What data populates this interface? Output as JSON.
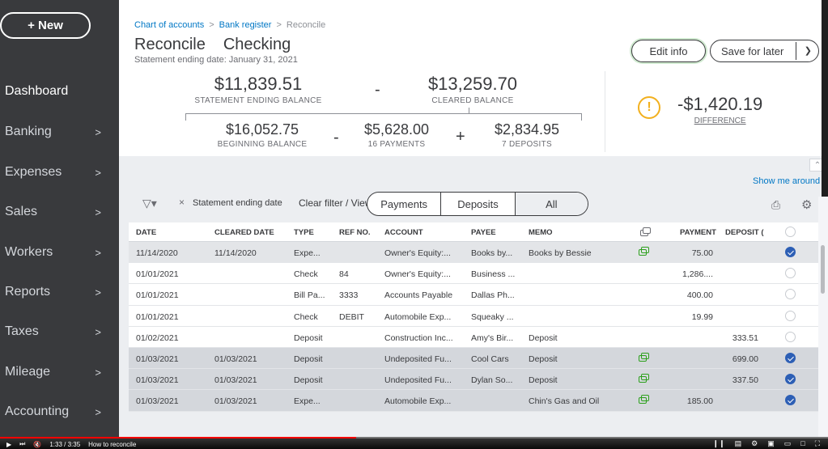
{
  "sidebar": {
    "new_label": "+ New",
    "items": [
      {
        "label": "Dashboard",
        "chevron": false
      },
      {
        "label": "Banking",
        "chevron": true
      },
      {
        "label": "Expenses",
        "chevron": true
      },
      {
        "label": "Sales",
        "chevron": true
      },
      {
        "label": "Workers",
        "chevron": true
      },
      {
        "label": "Reports",
        "chevron": true
      },
      {
        "label": "Taxes",
        "chevron": true
      },
      {
        "label": "Mileage",
        "chevron": true
      },
      {
        "label": "Accounting",
        "chevron": true
      }
    ],
    "chevron_glyph": ">"
  },
  "breadcrumb": {
    "item1": "Chart of accounts",
    "sep": ">",
    "item2": "Bank register",
    "item3": "Reconcile"
  },
  "header": {
    "title_part1": "Reconcile",
    "title_part2": "Checking",
    "subtitle": "Statement ending date: January 31, 2021",
    "edit_info": "Edit info",
    "save_for_later": "Save for later"
  },
  "summary": {
    "statement_ending_balance": "$11,839.51",
    "statement_ending_balance_label": "STATEMENT ENDING BALANCE",
    "minus": "-",
    "cleared_balance": "$13,259.70",
    "cleared_balance_label": "CLEARED BALANCE",
    "beginning_balance": "$16,052.75",
    "beginning_balance_label": "BEGINNING BALANCE",
    "payments_total": "$5,628.00",
    "payments_label": "16 PAYMENTS",
    "plus": "+",
    "deposits_total": "$2,834.95",
    "deposits_label": "7 DEPOSITS",
    "difference": "-$1,420.19",
    "difference_label": "DIFFERENCE",
    "warning_glyph": "!"
  },
  "toolbar": {
    "show_me_around": "Show me around",
    "filter_chip": "Statement ending date",
    "clear_filter": "Clear filter / View all",
    "tabs": [
      "Payments",
      "Deposits",
      "All"
    ],
    "active_tab": "All"
  },
  "table": {
    "columns": [
      "DATE",
      "CLEARED DATE",
      "TYPE",
      "REF NO.",
      "ACCOUNT",
      "PAYEE",
      "MEMO",
      "PAYMENT",
      "DEPOSIT ("
    ],
    "rows": [
      {
        "date": "11/14/2020",
        "cleared": "11/14/2020",
        "type": "Expe...",
        "ref": "",
        "account": "Owner's Equity:...",
        "payee": "Books by...",
        "memo": "Books by Bessie",
        "attach": true,
        "payment": "75.00",
        "deposit": "",
        "checked": true,
        "style": "sel"
      },
      {
        "date": "01/01/2021",
        "cleared": "",
        "type": "Check",
        "ref": "84",
        "account": "Owner's Equity:...",
        "payee": "Business ...",
        "memo": "",
        "attach": false,
        "payment": "1,286....",
        "deposit": "",
        "checked": false,
        "style": ""
      },
      {
        "date": "01/01/2021",
        "cleared": "",
        "type": "Bill Pa...",
        "ref": "3333",
        "account": "Accounts Payable",
        "payee": "Dallas Ph...",
        "memo": "",
        "attach": false,
        "payment": "400.00",
        "deposit": "",
        "checked": false,
        "style": ""
      },
      {
        "date": "01/01/2021",
        "cleared": "",
        "type": "Check",
        "ref": "DEBIT",
        "account": "Automobile Exp...",
        "payee": "Squeaky ...",
        "memo": "",
        "attach": false,
        "payment": "19.99",
        "deposit": "",
        "checked": false,
        "style": ""
      },
      {
        "date": "01/02/2021",
        "cleared": "",
        "type": "Deposit",
        "ref": "",
        "account": "Construction Inc...",
        "payee": "Amy's Bir...",
        "memo": "Deposit",
        "attach": false,
        "payment": "",
        "deposit": "333.51",
        "checked": false,
        "style": ""
      },
      {
        "date": "01/03/2021",
        "cleared": "01/03/2021",
        "type": "Deposit",
        "ref": "",
        "account": "Undeposited Fu...",
        "payee": "Cool Cars",
        "memo": "Deposit",
        "attach": true,
        "payment": "",
        "deposit": "699.00",
        "checked": true,
        "style": "hl"
      },
      {
        "date": "01/03/2021",
        "cleared": "01/03/2021",
        "type": "Deposit",
        "ref": "",
        "account": "Undeposited Fu...",
        "payee": "Dylan So...",
        "memo": "Deposit",
        "attach": true,
        "payment": "",
        "deposit": "337.50",
        "checked": true,
        "style": "hl"
      },
      {
        "date": "01/03/2021",
        "cleared": "01/03/2021",
        "type": "Expe...",
        "ref": "",
        "account": "Automobile Exp...",
        "payee": "",
        "memo": "Chin's Gas and Oil",
        "attach": true,
        "payment": "185.00",
        "deposit": "",
        "checked": true,
        "style": "hl"
      }
    ]
  },
  "player": {
    "time": "1:33 / 3:35",
    "title": "How to reconcile",
    "progress_fraction": 0.43
  },
  "colors": {
    "sidebar": "#393a3d",
    "link": "#0077c5",
    "warning": "#f2b01e",
    "attach": "#2ca01c",
    "check": "#2d5fb5",
    "progress": "#ff0000"
  },
  "icons": {
    "filter": "filter-icon",
    "print": "print-icon",
    "settings": "gear-icon",
    "attachment": "attachment-icon",
    "warning": "warning-icon"
  }
}
